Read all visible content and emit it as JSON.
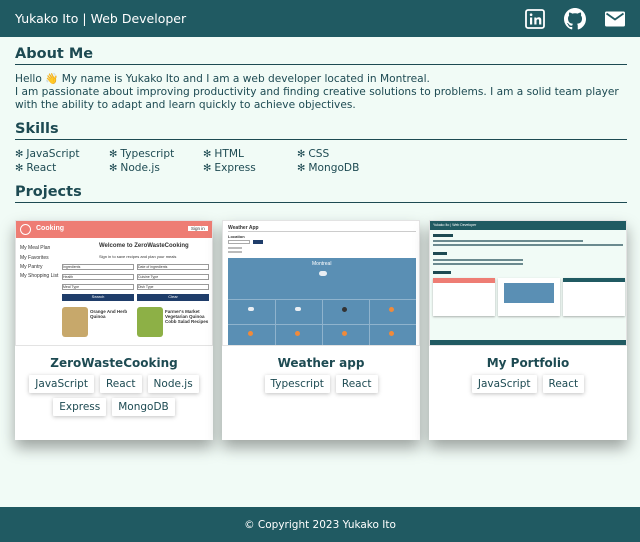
{
  "header": {
    "title": "Yukako Ito | Web Developer",
    "icons": [
      "linkedin-icon",
      "github-icon",
      "mail-icon"
    ]
  },
  "about": {
    "title": "About Me",
    "line1": "Hello 👋 My name is Yukako Ito and I am a web developer located in Montreal.",
    "line2": "I am passionate about improving productivity and finding creative solutions to problems. I am a solid team player with the ability to adapt and learn quickly to achieve objectives."
  },
  "skills": {
    "title": "Skills",
    "icon": "✻",
    "items": [
      "JavaScript",
      "Typescript",
      "HTML",
      "CSS",
      "React",
      "Node.js",
      "Express",
      "MongoDB"
    ]
  },
  "projects": {
    "title": "Projects",
    "items": [
      {
        "name": "ZeroWasteCooking",
        "tags": [
          "JavaScript",
          "React",
          "Node.js",
          "Express",
          "MongoDB"
        ],
        "preview": {
          "app_name": "Cooking",
          "sign_in": "Sign in",
          "welcome": "Welcome to ZeroWasteCooking",
          "subtitle": "Sign in to save recipes and plan your meals",
          "menu": [
            "My Meal Plan",
            "My Favorites",
            "My Pantry",
            "My Shopping List"
          ],
          "fields": [
            "Ingredients",
            "Date of ingredients",
            "Health",
            "Cuisine Type",
            "Meal Type",
            "Dish Type"
          ],
          "search": "Search",
          "clear": "Clear",
          "recipe1": "Orange And Herb Quinoa",
          "recipe2": "Farmer's Market Vegetarian Quinoa Cobb Salad Recipes"
        }
      },
      {
        "name": "Weather app",
        "tags": [
          "Typescript",
          "React"
        ],
        "preview": {
          "app_name": "Weather App",
          "location_label": "Location",
          "city": "Montreal"
        }
      },
      {
        "name": "My Portfolio",
        "tags": [
          "JavaScript",
          "React"
        ],
        "preview": {
          "title": "Yukako Ito | Web Developer"
        }
      }
    ]
  },
  "footer": {
    "text": "© Copyright 2023 Yukako Ito"
  },
  "colors": {
    "header_bg": "#205a62",
    "page_bg": "#f1fbf6",
    "text": "#1d4a52"
  }
}
